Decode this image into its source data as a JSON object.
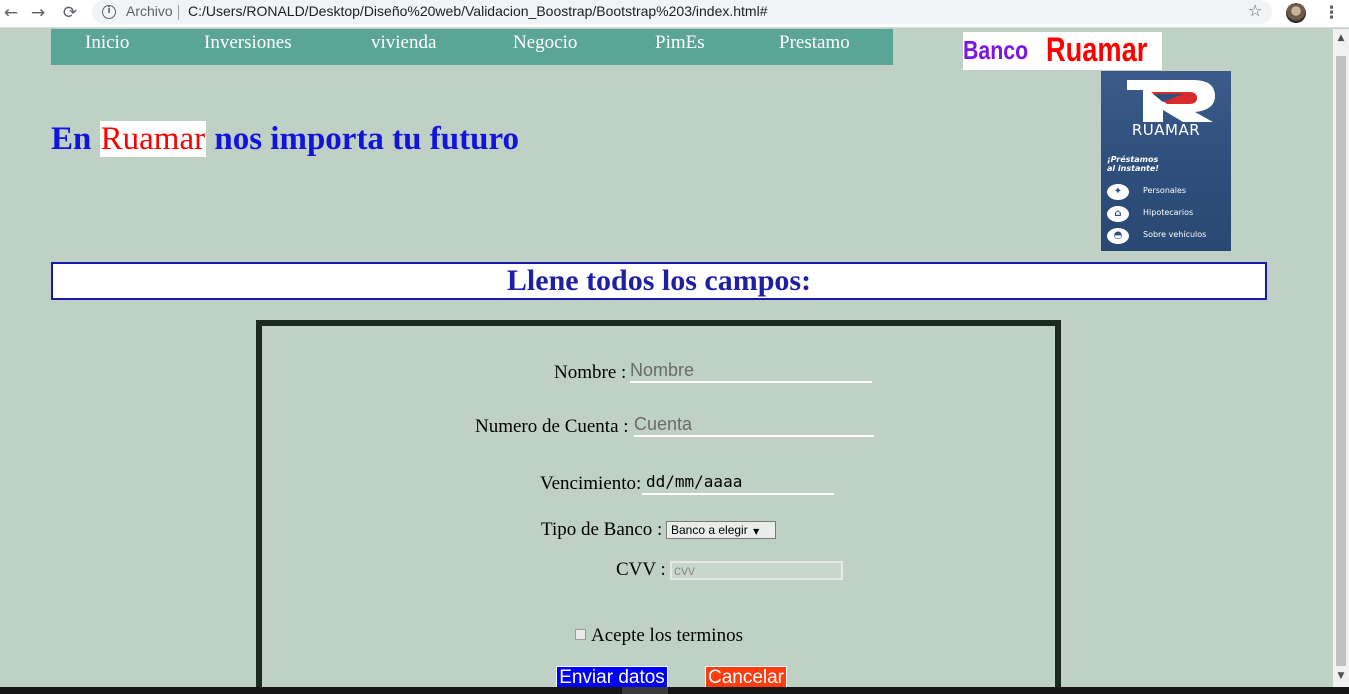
{
  "browser": {
    "back_icon": "←",
    "forward_icon": "→",
    "reload_icon": "⟳",
    "scheme": "Archivo",
    "url": "C:/Users/RONALD/Desktop/Diseño%20web/Validacion_Boostrap/Bootstrap%203/index.html#",
    "star_icon": "☆",
    "menu_icon": "⋮",
    "info_icon": "i"
  },
  "nav": {
    "items": [
      {
        "label": "Inicio"
      },
      {
        "label": "Inversiones"
      },
      {
        "label": "vivienda"
      },
      {
        "label": "Negocio"
      },
      {
        "label": "PimEs"
      },
      {
        "label": "Prestamo"
      }
    ],
    "background": "#5ba596"
  },
  "brand": {
    "part1": "Banco",
    "part2": "Ruamar",
    "part1_color": "#7a16e6",
    "part2_color": "#ff0000"
  },
  "promo": {
    "name": "RUAMAR",
    "tagline_1": "¡Préstamos",
    "tagline_2": "al instante!",
    "items": [
      {
        "icon": "personal-loan-icon",
        "glyph": "✦",
        "label": "Personales"
      },
      {
        "icon": "house-icon",
        "glyph": "⌂",
        "label": "Hipotecarios"
      },
      {
        "icon": "car-icon",
        "glyph": "◓",
        "label": "Sobre vehículos"
      }
    ]
  },
  "headline": {
    "pre": "En ",
    "highlight": "Ruamar",
    "post": " nos importa tu futuro"
  },
  "banner": {
    "text": "Llene todos los campos:"
  },
  "form": {
    "nombre_label": "Nombre :",
    "nombre_placeholder": "Nombre",
    "cuenta_label": "Numero de Cuenta :",
    "cuenta_placeholder": "Cuenta",
    "vencimiento_label": "Vencimiento:",
    "vencimiento_value": "dd/mm/aaaa",
    "tipo_label": "Tipo de Banco :",
    "tipo_selected": "Banco a elegir",
    "cvv_label": "CVV :",
    "cvv_placeholder": "cvv",
    "terms_label": "Acepte los terminos",
    "submit_label": "Enviar datos",
    "cancel_label": "Cancelar"
  },
  "scroll": {
    "up_icon": "▲",
    "down_icon": "▼"
  },
  "colors": {
    "page_bg": "#bfd1c5",
    "headline_blue": "#1313e0",
    "banner_blue": "#1f1fa5",
    "form_border": "#1b2a1c",
    "submit_bg": "#0000ff",
    "cancel_bg": "#ff3b10"
  }
}
